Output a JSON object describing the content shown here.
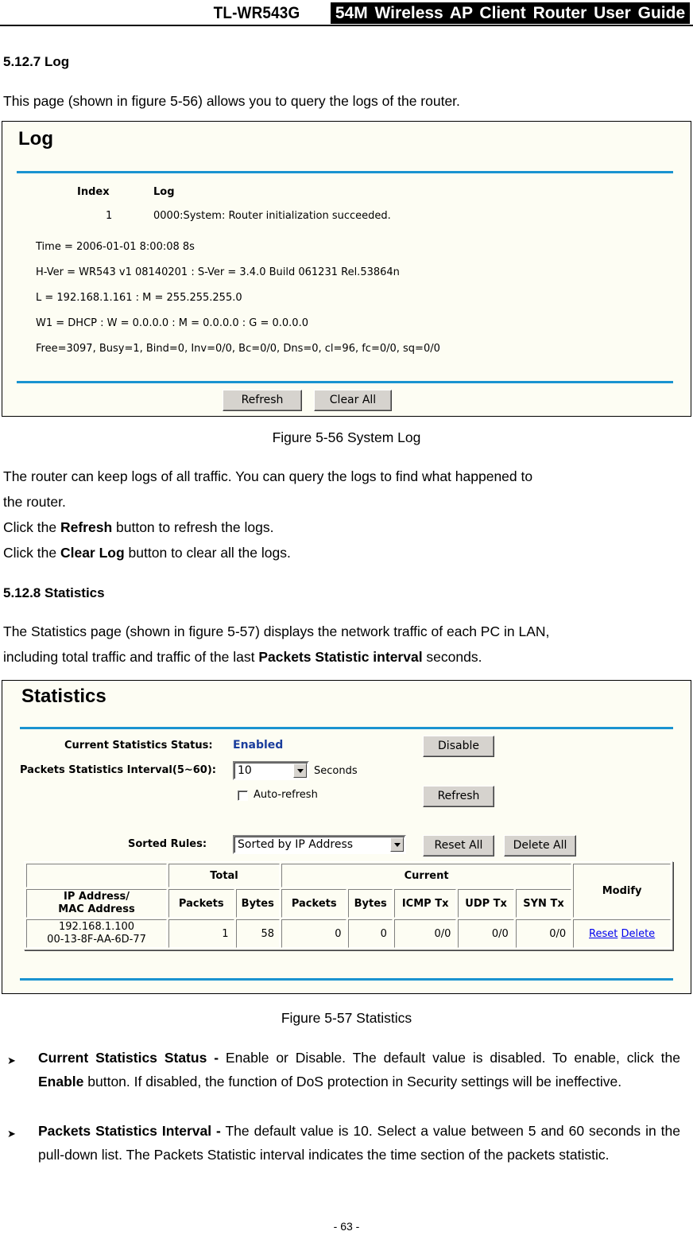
{
  "header": {
    "model": "TL-WR543G",
    "guide_title": "54M  Wireless  AP  Client  Router  User  Guide"
  },
  "log_section": {
    "heading": "5.12.7 Log",
    "intro": "This page (shown in figure 5-56) allows you to query the logs of the router.",
    "figure": {
      "title": "Log",
      "columns": {
        "index": "Index",
        "log": "Log"
      },
      "rows": [
        {
          "index": "1",
          "log": "0000:System: Router initialization succeeded."
        }
      ],
      "info_lines": [
        "Time = 2006-01-01 8:00:08 8s",
        "H-Ver = WR543 v1 08140201 : S-Ver = 3.4.0 Build 061231 Rel.53864n",
        "L = 192.168.1.161 : M = 255.255.255.0",
        "W1 = DHCP : W = 0.0.0.0 : M = 0.0.0.0 : G = 0.0.0.0",
        "Free=3097, Busy=1, Bind=0, Inv=0/0, Bc=0/0, Dns=0, cl=96, fc=0/0, sq=0/0"
      ],
      "buttons": {
        "refresh": "Refresh",
        "clear_all": "Clear All"
      }
    },
    "caption": "Figure 5-56    System Log",
    "para1": "The router can keep logs of all traffic. You can query the logs to find what happened to",
    "para1b": "the router.",
    "click_refresh": {
      "pre": "Click the ",
      "bold": "Refresh",
      "post": " button to refresh the logs."
    },
    "click_clear": {
      "pre": "Click the ",
      "bold": "Clear Log",
      "post": " button to clear all the logs."
    }
  },
  "stats_section": {
    "heading": "5.12.8 Statistics",
    "intro1": "The Statistics page (shown in figure 5-57) displays the network traffic of each PC in LAN,",
    "intro2": {
      "pre": "including total traffic and traffic of the last ",
      "bold": "Packets Statistic interval",
      "post": " seconds."
    },
    "figure": {
      "title": "Statistics",
      "status_label": "Current Statistics Status:",
      "status_value": "Enabled",
      "status_color": "#1a3d9c",
      "interval_label": "Packets Statistics Interval(5~60):",
      "interval_value": "10",
      "interval_unit": "Seconds",
      "auto_refresh_label": "Auto-refresh",
      "auto_refresh_checked": false,
      "sorted_label": "Sorted Rules:",
      "sorted_value": "Sorted by IP Address",
      "buttons": {
        "disable": "Disable",
        "refresh": "Refresh",
        "reset_all": "Reset All",
        "delete_all": "Delete All"
      },
      "table": {
        "group_headers": {
          "total": "Total",
          "current": "Current",
          "modify": "Modify"
        },
        "columns": {
          "address": [
            "IP Address/",
            "MAC Address"
          ],
          "total_packets": "Packets",
          "total_bytes": "Bytes",
          "cur_packets": "Packets",
          "cur_bytes": "Bytes",
          "icmp": "ICMP Tx",
          "udp": "UDP Tx",
          "syn": "SYN Tx"
        },
        "rows": [
          {
            "ip": "192.168.1.100",
            "mac": "00-13-8F-AA-6D-77",
            "total_packets": "1",
            "total_bytes": "58",
            "cur_packets": "0",
            "cur_bytes": "0",
            "icmp": "0/0",
            "udp": "0/0",
            "syn": "0/0",
            "reset": "Reset",
            "delete": "Delete"
          }
        ]
      }
    },
    "caption": "Figure 5-57    Statistics",
    "bullets": [
      {
        "bold": "Current Statistics Status -",
        "text1": " Enable or Disable. The default value is disabled. To enable, click the ",
        "bold2": "Enable",
        "text2": " button. If disabled, the function of DoS protection in Security settings will be ineffective."
      },
      {
        "bold": "Packets Statistics Interval -",
        "text1": " The default value is 10. Select a value between 5 and 60 seconds in the pull-down list. The Packets Statistic interval indicates the time section of the packets statistic."
      }
    ]
  },
  "footer": {
    "page": "- 63 -"
  }
}
